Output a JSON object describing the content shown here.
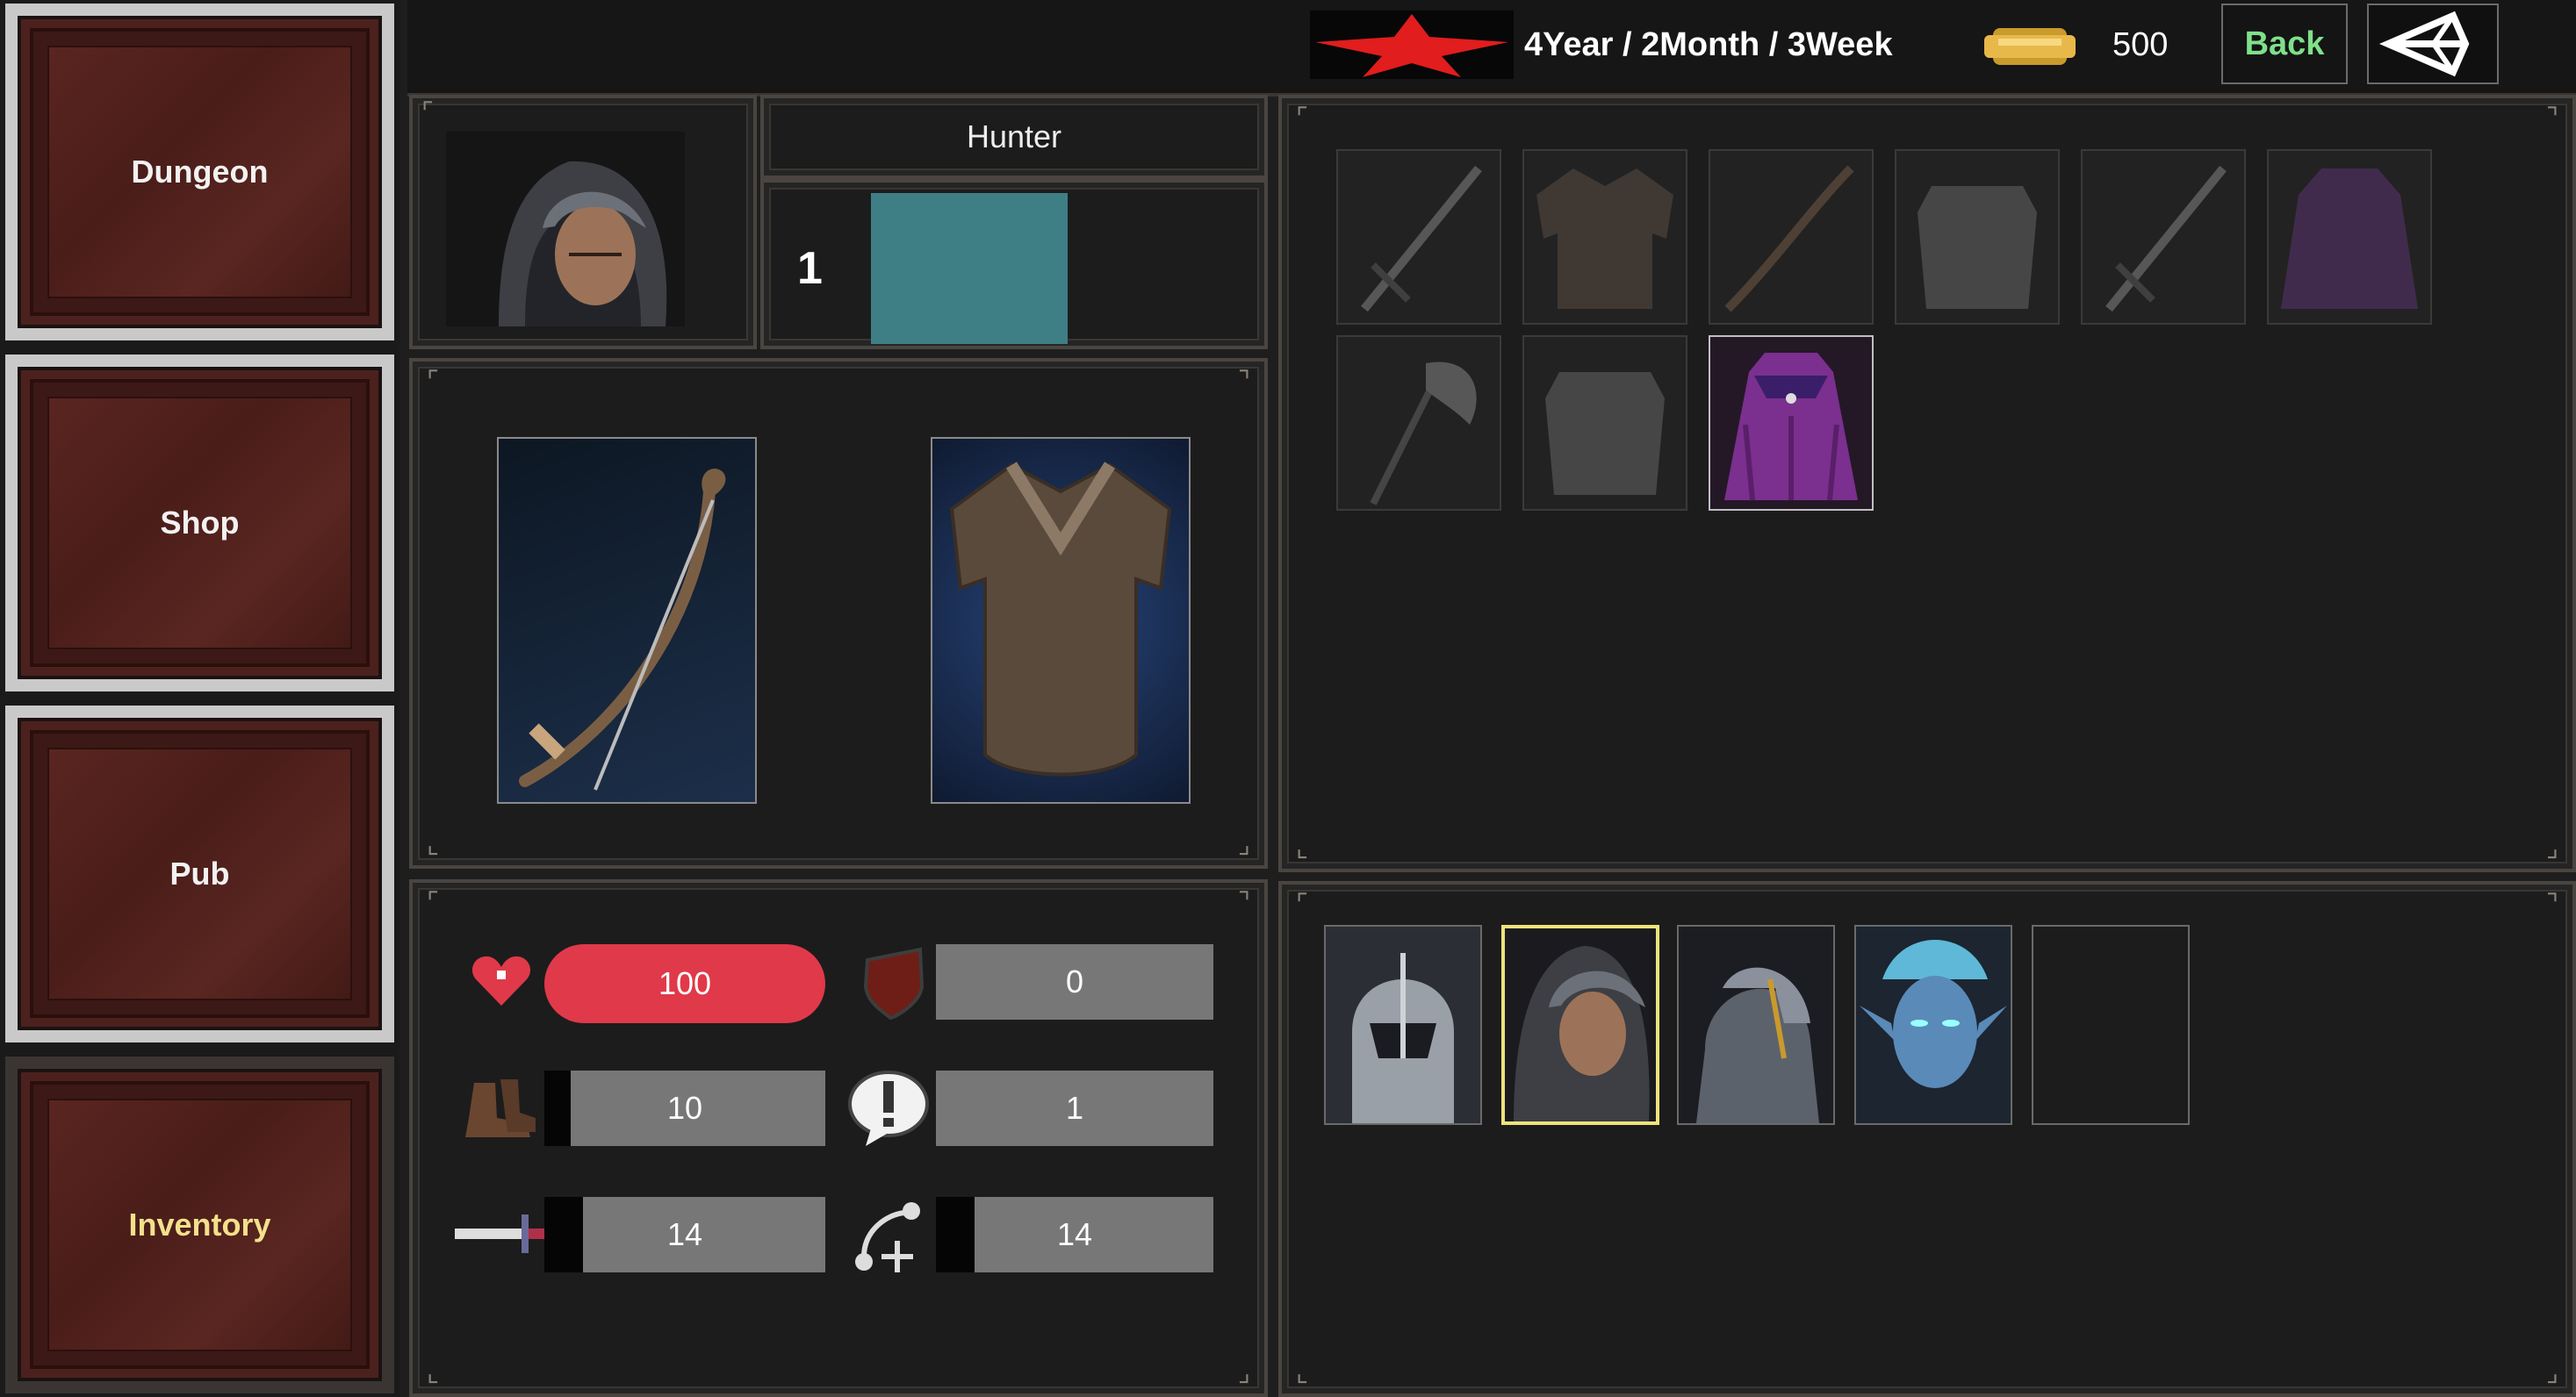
{
  "nav": {
    "items": [
      {
        "label": "Dungeon",
        "active": false
      },
      {
        "label": "Shop",
        "active": false
      },
      {
        "label": "Pub",
        "active": false
      },
      {
        "label": "Inventory",
        "active": true
      }
    ]
  },
  "topbar": {
    "date": "4Year / 2Month / 3Week",
    "gold": "500",
    "back_label": "Back",
    "rank_icon": "red-star-icon",
    "gold_icon": "gold-coin-icon",
    "unity_icon": "unity-logo-icon"
  },
  "character": {
    "class_name": "Hunter",
    "level": "1",
    "portrait_icon": "hooded-hunter-portrait",
    "xp_color": "#3e7f86"
  },
  "equipment": {
    "weapon_icon": "bow-icon",
    "armor_icon": "leather-tunic-icon"
  },
  "stats": {
    "hp": "100",
    "defense": "0",
    "speed": "10",
    "crit": "1",
    "attack": "14",
    "skill": "14",
    "hp_color": "#e0394a"
  },
  "inventory": {
    "items": [
      {
        "icon": "sword-icon",
        "dim": true
      },
      {
        "icon": "leather-tunic-icon",
        "dim": true
      },
      {
        "icon": "bow-icon",
        "dim": true
      },
      {
        "icon": "plate-armor-icon",
        "dim": true
      },
      {
        "icon": "sword-icon",
        "dim": true
      },
      {
        "icon": "purple-cloak-icon",
        "dim": true
      },
      {
        "icon": "axe-icon",
        "dim": true
      },
      {
        "icon": "plate-armor-icon",
        "dim": true
      },
      {
        "icon": "purple-cloak-icon",
        "dim": false
      }
    ]
  },
  "party": {
    "members": [
      {
        "icon": "knight-portrait",
        "selected": false
      },
      {
        "icon": "hooded-hunter-portrait",
        "selected": true
      },
      {
        "icon": "armored-paladin-portrait",
        "selected": false
      },
      {
        "icon": "blue-elf-portrait",
        "selected": false
      },
      {
        "icon": "empty-slot",
        "selected": false
      }
    ],
    "selected_color": "#efe37a"
  }
}
